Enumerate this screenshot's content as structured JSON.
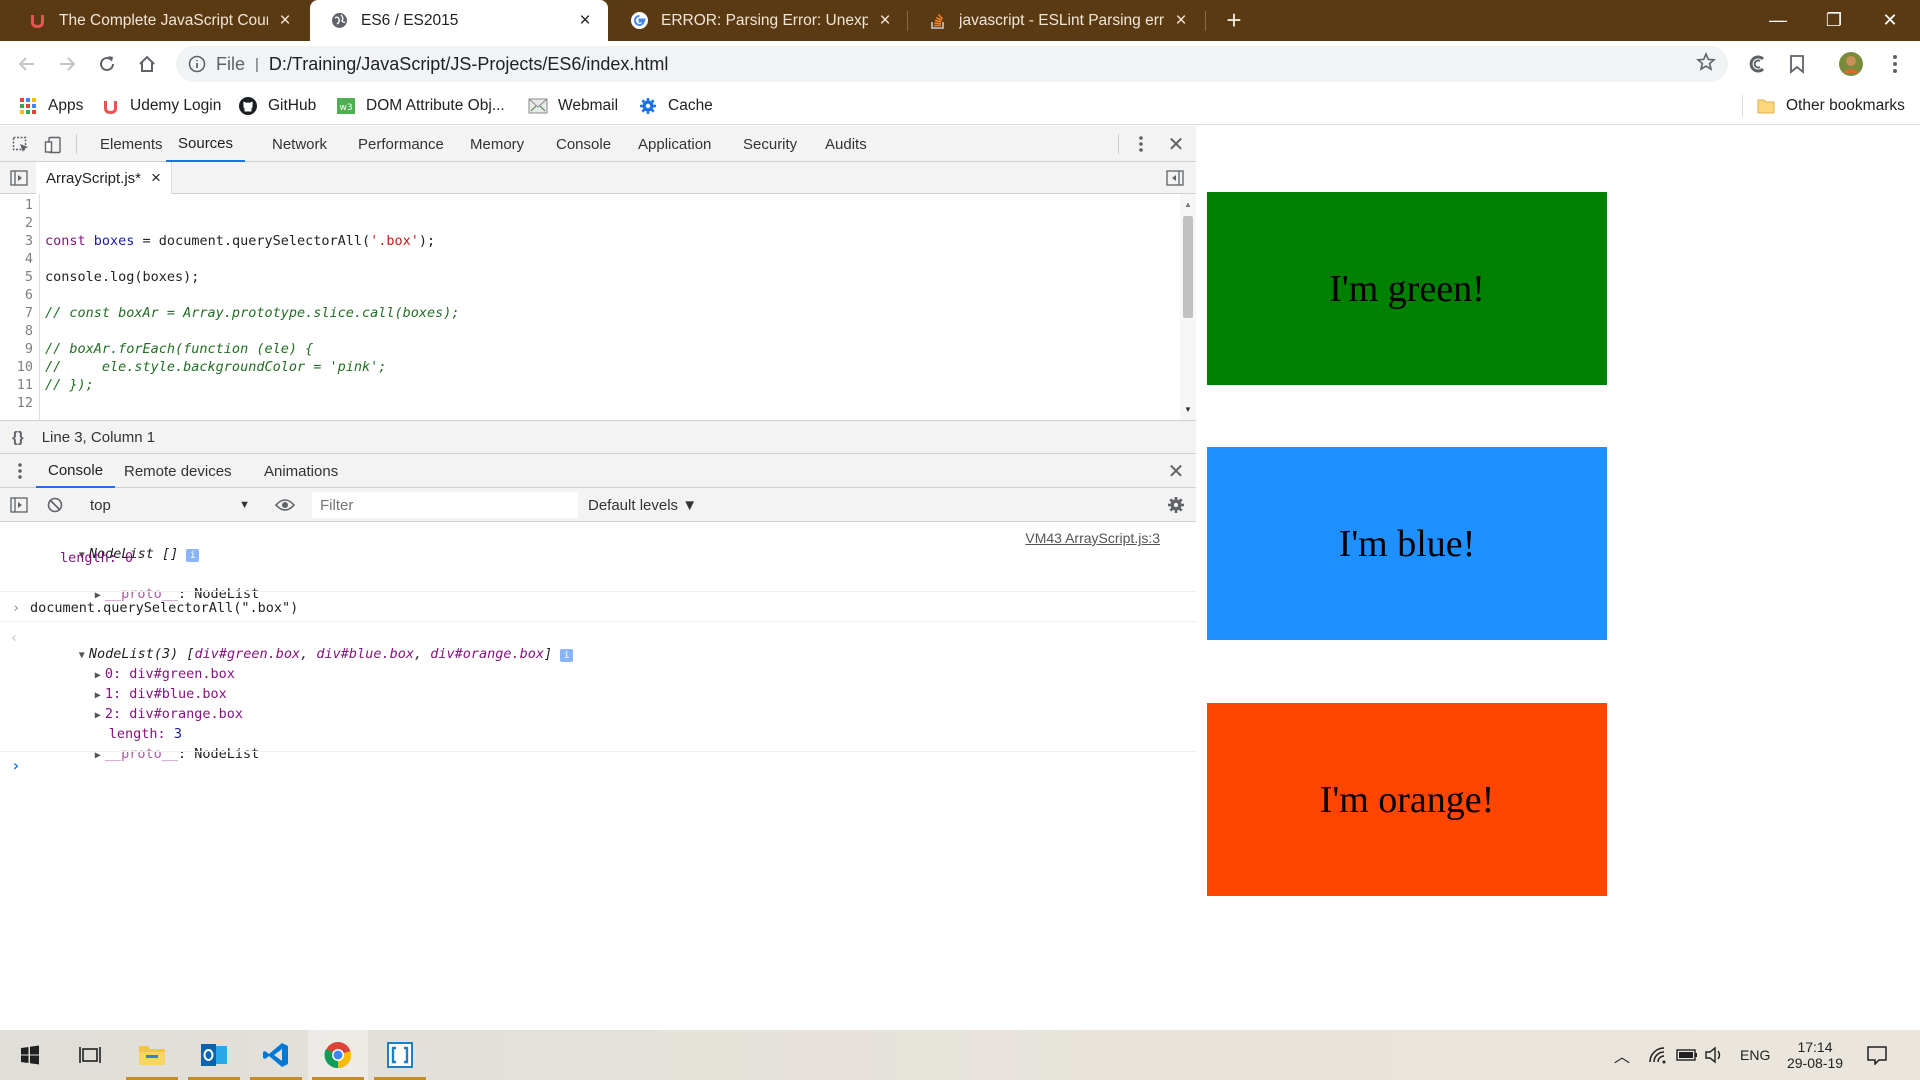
{
  "browser": {
    "tabs": [
      {
        "title": "The Complete JavaScript Course",
        "icon": "udemy-icon",
        "active": false
      },
      {
        "title": "ES6 / ES2015",
        "icon": "globe-icon",
        "active": true
      },
      {
        "title": "ERROR: Parsing Error: Unexpected",
        "icon": "google-icon",
        "active": false
      },
      {
        "title": "javascript - ESLint Parsing error: U",
        "icon": "stackoverflow-icon",
        "active": false
      }
    ],
    "new_tab": "+",
    "window_controls": {
      "minimize": "—",
      "restore": "❐",
      "close": "✕"
    },
    "address": {
      "scheme": "File",
      "url": "D:/Training/JavaScript/JS-Projects/ES6/index.html"
    },
    "bookmarks": [
      {
        "label": "Apps",
        "icon": "apps-grid-icon"
      },
      {
        "label": "Udemy Login",
        "icon": "udemy-icon"
      },
      {
        "label": "GitHub",
        "icon": "github-icon"
      },
      {
        "label": "DOM Attribute Obj...",
        "icon": "w3schools-icon"
      },
      {
        "label": "Webmail",
        "icon": "mail-icon"
      },
      {
        "label": "Cache",
        "icon": "gear-icon"
      }
    ],
    "other_bookmarks": "Other bookmarks"
  },
  "devtools": {
    "tabs": [
      "Elements",
      "Sources",
      "Network",
      "Performance",
      "Memory",
      "Console",
      "Application",
      "Security",
      "Audits"
    ],
    "active_tab": "Sources",
    "file_tab": {
      "name": "ArrayScript.js*",
      "close": "×"
    },
    "line_numbers": [
      "1",
      "2",
      "3",
      "4",
      "5",
      "6",
      "7",
      "8",
      "9",
      "10",
      "11",
      "12"
    ],
    "status": {
      "braces": "{}",
      "position": "Line 3, Column 1"
    },
    "drawer_tabs": [
      "Console",
      "Remote devices",
      "Animations"
    ],
    "console_toolbar": {
      "context": "top",
      "filter_placeholder": "Filter",
      "levels": "Default levels ▼"
    },
    "console": {
      "msg1_header": "NodeList []",
      "msg1_source": "VM43 ArrayScript.js:3",
      "msg1_length": "length: 0",
      "msg1_proto_key": "__proto__",
      "msg1_proto_val": ": NodeList",
      "input_cmd": "document.querySelectorAll(\".box\")",
      "out_header_prefix": "NodeList(3) [",
      "out_header_items": [
        "div#green.box",
        "div#blue.box",
        "div#orange.box"
      ],
      "out_items": [
        {
          "index": "0:",
          "value": "div#green.box"
        },
        {
          "index": "1:",
          "value": "div#blue.box"
        },
        {
          "index": "2:",
          "value": "div#orange.box"
        }
      ],
      "out_length_key": "length:",
      "out_length_val": "3",
      "prompt": "›"
    }
  },
  "page": {
    "boxes": [
      {
        "text": "I'm green!",
        "color": "#008000"
      },
      {
        "text": "I'm blue!",
        "color": "#1e90ff"
      },
      {
        "text": "I'm orange!",
        "color": "#ff4500"
      }
    ]
  },
  "taskbar": {
    "apps": [
      "windows-start-icon",
      "task-view-icon",
      "file-explorer-icon",
      "outlook-icon",
      "vscode-icon",
      "chrome-icon",
      "brackets-icon"
    ],
    "language": "ENG",
    "time": "17:14",
    "date": "29-08-19"
  },
  "colors": {
    "tab_strip": "#5a3a12",
    "devtools_accent": "#1a73e8"
  }
}
